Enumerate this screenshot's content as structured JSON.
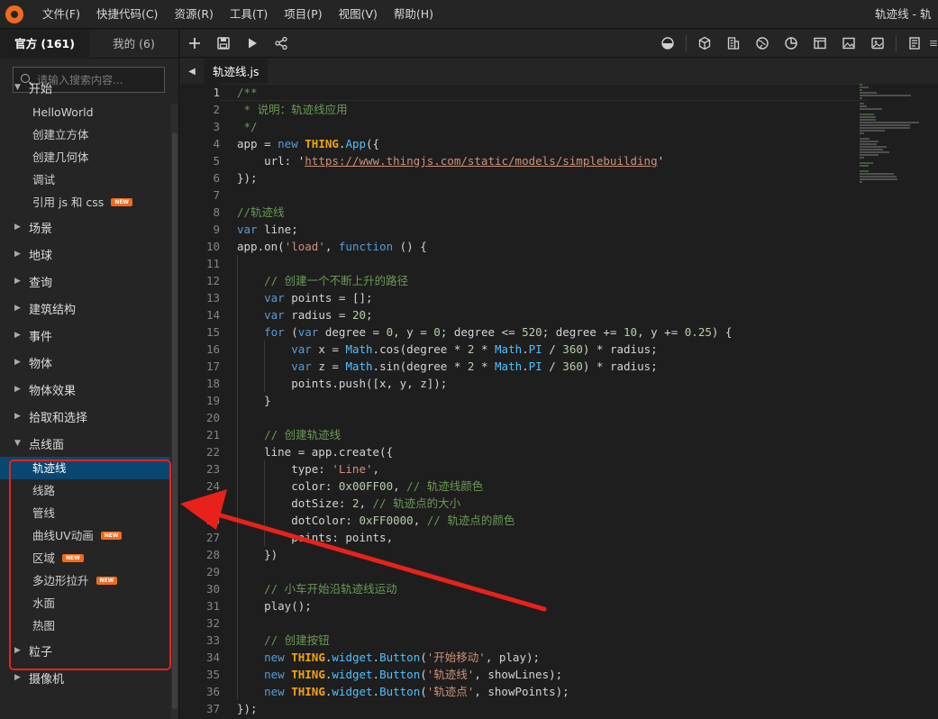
{
  "menubar": {
    "items": [
      "文件(F)",
      "快捷代码(C)",
      "资源(R)",
      "工具(T)",
      "项目(P)",
      "视图(V)",
      "帮助(H)"
    ],
    "window_title": "轨迹线 -  轨"
  },
  "sidebar": {
    "tabs": [
      "官方 (161)",
      "我的 (6)"
    ],
    "search_placeholder": "请输入搜索内容...",
    "categories": [
      {
        "label": "开始",
        "expanded": true,
        "items": [
          {
            "label": "HelloWorld"
          },
          {
            "label": "创建立方体"
          },
          {
            "label": "创建几何体"
          },
          {
            "label": "调试"
          },
          {
            "label": "引用 js 和 css",
            "badge": "NEW"
          }
        ]
      },
      {
        "label": "场景"
      },
      {
        "label": "地球"
      },
      {
        "label": "查询"
      },
      {
        "label": "建筑结构"
      },
      {
        "label": "事件"
      },
      {
        "label": "物体"
      },
      {
        "label": "物体效果"
      },
      {
        "label": "拾取和选择"
      },
      {
        "label": "点线面",
        "expanded": true,
        "items": [
          {
            "label": "轨迹线",
            "selected": true
          },
          {
            "label": "线路"
          },
          {
            "label": "管线"
          },
          {
            "label": "曲线UV动画",
            "badge": "NEW"
          },
          {
            "label": "区域",
            "badge": "NEW"
          },
          {
            "label": "多边形拉升",
            "badge": "NEW"
          },
          {
            "label": "水面"
          },
          {
            "label": "热图"
          }
        ]
      },
      {
        "label": "粒子"
      },
      {
        "label": "摄像机"
      }
    ]
  },
  "toolbar": {
    "left_icons": [
      "plus-icon",
      "save-icon",
      "play-icon",
      "share-icon"
    ],
    "right_icons": [
      "sky-icon",
      "cube-icon",
      "building-icon",
      "globe-icon",
      "chart-icon",
      "panel-icon",
      "image-icon",
      "picture-icon",
      "doc-icon",
      "list-icon"
    ]
  },
  "editor": {
    "back_icon": "◀",
    "tab_label": "轨迹线.js",
    "current_line": 1,
    "line_numbers": [
      "1",
      "2",
      "3",
      "4",
      "5",
      "6",
      "7",
      "8",
      "9",
      "10",
      "11",
      "12",
      "13",
      "14",
      "15",
      "16",
      "17",
      "18",
      "19",
      "20",
      "21",
      "22",
      "23",
      "24",
      "25",
      "26",
      "27",
      "28",
      "29",
      "30",
      "31",
      "32",
      "33",
      "34",
      "35",
      "36",
      "37"
    ],
    "code_lines": [
      "/**",
      " * 说明：轨迹线应用",
      " */",
      "app = new THING.App({",
      "    url: 'https://www.thingjs.com/static/models/simplebuilding'",
      "});",
      "",
      "//轨迹线",
      "var line;",
      "app.on('load', function () {",
      "",
      "    // 创建一个不断上升的路径",
      "    var points = [];",
      "    var radius = 20;",
      "    for (var degree = 0, y = 0; degree <= 520; degree += 10, y += 0.25) {",
      "        var x = Math.cos(degree * 2 * Math.PI / 360) * radius;",
      "        var z = Math.sin(degree * 2 * Math.PI / 360) * radius;",
      "        points.push([x, y, z]);",
      "    }",
      "",
      "    // 创建轨迹线",
      "    line = app.create({",
      "        type: 'Line',",
      "        color: 0x00FF00, // 轨迹线颜色",
      "        dotSize: 2, // 轨迹点的大小",
      "        dotColor: 0xFF0000, // 轨迹点的颜色",
      "        points: points,",
      "    })",
      "",
      "    // 小车开始沿轨迹线运动",
      "    play();",
      "",
      "    // 创建按钮",
      "    new THING.widget.Button('开始移动', play);",
      "    new THING.widget.Button('轨迹线', showLines);",
      "    new THING.widget.Button('轨迹点', showPoints);",
      "});"
    ]
  },
  "annotation": {
    "color": "#e8221a"
  }
}
